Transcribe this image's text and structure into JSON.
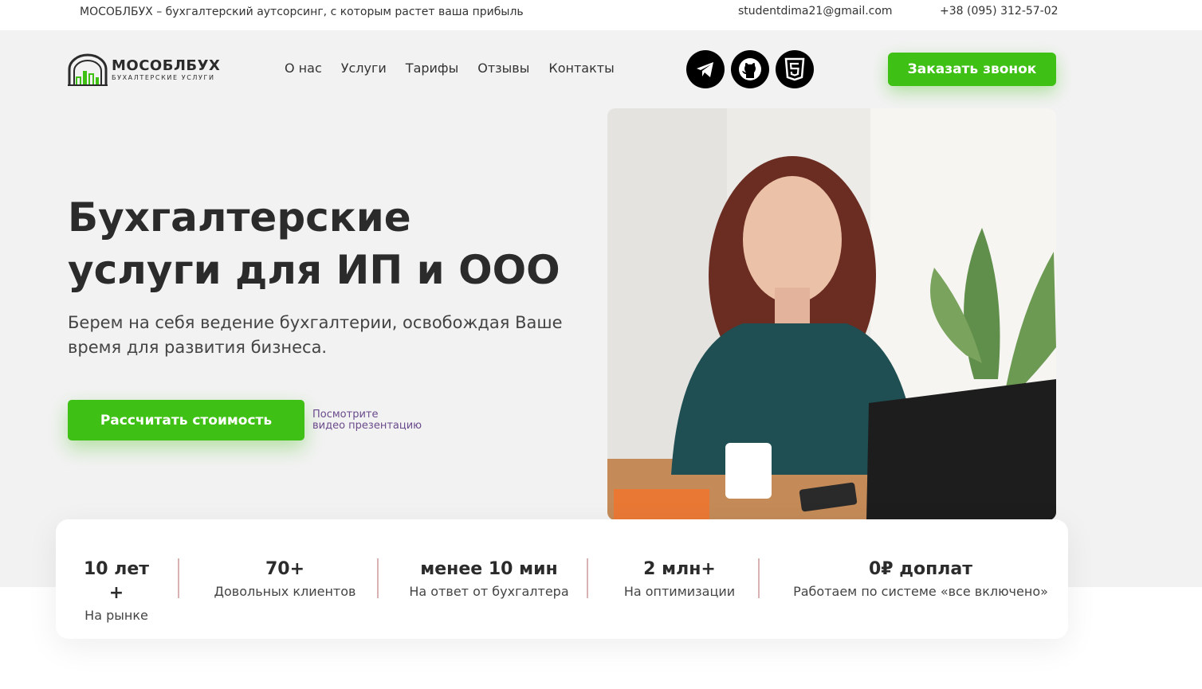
{
  "topbar": {
    "tagline": "МОСОБЛБУХ – бухгалтерский аутсорсинг, с которым растет ваша прибыль",
    "email": "studentdima21@gmail.com",
    "phone": "+38 (095) 312-57-02"
  },
  "logo": {
    "title": "МОСОБЛБУХ",
    "subtitle": "БУХАЛТЕРСКИЕ УСЛУГИ"
  },
  "nav": {
    "items": [
      "О нас",
      "Услуги",
      "Тарифы",
      "Отзывы",
      "Контакты"
    ]
  },
  "socials": [
    "telegram-icon",
    "github-icon",
    "html5-icon"
  ],
  "header": {
    "call_label": "Заказать звонок"
  },
  "hero": {
    "title_line1": "Бухгалтерские",
    "title_line2": "услуги для ИП и ООО",
    "subtitle": "Берем на себя ведение бухгалтерии, освобождая Ваше время для развития бизнеса.",
    "calc_label": "Рассчитать стоимость",
    "video_line1": "Посмотрите",
    "video_line2": "видео презентацию"
  },
  "stats": [
    {
      "value": "10 лет +",
      "label": "На рынке"
    },
    {
      "value": "70+",
      "label": "Довольных клиентов"
    },
    {
      "value": "менее 10 мин",
      "label": "На ответ от бухгалтера"
    },
    {
      "value": "2 млн+",
      "label": "На оптимизации"
    },
    {
      "value": "0₽ доплат",
      "label": "Работаем по системе «все включено»"
    }
  ],
  "colors": {
    "accent": "#3fc015",
    "hero_bg": "#f2f2f2",
    "text": "#2b2b2b",
    "link": "#6a4a8c"
  }
}
